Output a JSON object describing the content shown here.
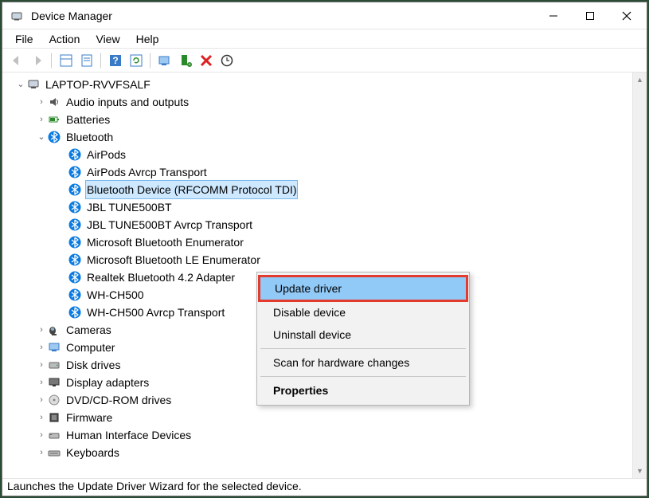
{
  "window": {
    "title": "Device Manager"
  },
  "menu": {
    "file": "File",
    "action": "Action",
    "view": "View",
    "help": "Help"
  },
  "toolbar_names": [
    "back-icon",
    "forward-icon",
    "up-icon",
    "properties-icon",
    "help-icon",
    "refresh-icon",
    "monitor-icon",
    "install-legacy-icon",
    "remove-icon",
    "scan-icon"
  ],
  "tree": {
    "root": "LAPTOP-RVVFSALF",
    "items": [
      {
        "label": "Audio inputs and outputs",
        "icon": "speaker-icon",
        "expandable": true
      },
      {
        "label": "Batteries",
        "icon": "battery-icon",
        "expandable": true
      },
      {
        "label": "Bluetooth",
        "icon": "bluetooth-icon",
        "expandable": true,
        "expanded": true,
        "children": [
          {
            "label": "AirPods"
          },
          {
            "label": "AirPods Avrcp Transport"
          },
          {
            "label": "Bluetooth Device (RFCOMM Protocol TDI)",
            "selected": true
          },
          {
            "label": "JBL TUNE500BT"
          },
          {
            "label": "JBL TUNE500BT Avrcp Transport"
          },
          {
            "label": "Microsoft Bluetooth Enumerator"
          },
          {
            "label": "Microsoft Bluetooth LE Enumerator"
          },
          {
            "label": "Realtek Bluetooth 4.2 Adapter"
          },
          {
            "label": "WH-CH500"
          },
          {
            "label": "WH-CH500 Avrcp Transport"
          }
        ]
      },
      {
        "label": "Cameras",
        "icon": "camera-icon",
        "expandable": true
      },
      {
        "label": "Computer",
        "icon": "computer-icon",
        "expandable": true
      },
      {
        "label": "Disk drives",
        "icon": "disk-icon",
        "expandable": true
      },
      {
        "label": "Display adapters",
        "icon": "display-icon",
        "expandable": true
      },
      {
        "label": "DVD/CD-ROM drives",
        "icon": "dvd-icon",
        "expandable": true
      },
      {
        "label": "Firmware",
        "icon": "firmware-icon",
        "expandable": true
      },
      {
        "label": "Human Interface Devices",
        "icon": "hid-icon",
        "expandable": true
      },
      {
        "label": "Keyboards",
        "icon": "keyboard-icon",
        "expandable": true
      }
    ]
  },
  "context_menu": {
    "items": [
      {
        "label": "Update driver",
        "highlighted": true
      },
      {
        "label": "Disable device"
      },
      {
        "label": "Uninstall device"
      },
      {
        "divider": true
      },
      {
        "label": "Scan for hardware changes"
      },
      {
        "divider": true
      },
      {
        "label": "Properties",
        "bold": true
      }
    ]
  },
  "status": "Launches the Update Driver Wizard for the selected device."
}
